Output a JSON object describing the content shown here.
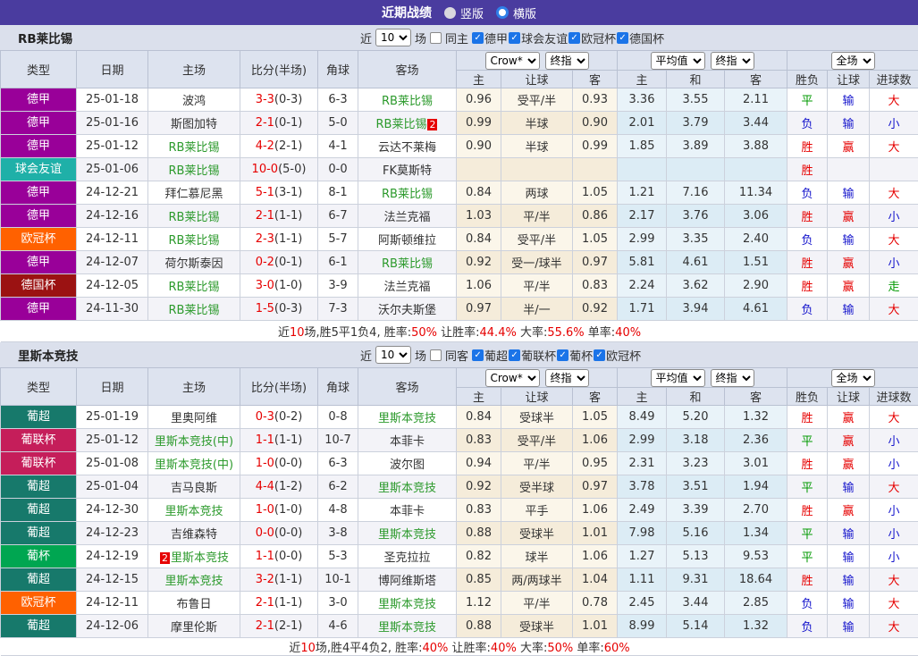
{
  "topbar": {
    "title": "近期战绩",
    "options": [
      {
        "label": "竖版",
        "selected": false
      },
      {
        "label": "横版",
        "selected": true
      }
    ]
  },
  "ui": {
    "near_label": "近",
    "matches_label": "场",
    "col_type": "类型",
    "col_date": "日期",
    "col_home": "主场",
    "col_score": "比分(半场)",
    "col_corner": "角球",
    "col_away": "客场",
    "sub_home": "主",
    "sub_handicap": "让球",
    "sub_away": "客",
    "sub_draw": "和",
    "sub_result": "胜负",
    "sub_goals": "进球数",
    "dd_crow": "Crow*",
    "dd_final": "终指",
    "dd_avg": "平均值",
    "dd_full": "全场"
  },
  "colors": {
    "topbar_bg": "#4a3c9f",
    "band_bg": "#dbe0ec",
    "header_bg": "#dde3ef",
    "checkbox_blue": "#1b74e8",
    "accent_red": "#e60000",
    "accent_blue": "#1414cc",
    "accent_green": "#009900",
    "team_green": "#2c9a2c",
    "badge": {
      "德甲": "#990099",
      "球会友谊": "#1fb0a8",
      "欧冠杯": "#ff6100",
      "德国杯": "#9b1212",
      "葡超": "#17796b",
      "葡联杯": "#c51e5a",
      "葡杯": "#00a651"
    }
  },
  "result_colors": {
    "胜": "red",
    "赢": "red",
    "大": "red",
    "负": "blue",
    "输": "blue",
    "小": "blue",
    "平": "green",
    "走": "green"
  },
  "tables": [
    {
      "team": "RB莱比锡",
      "near_count": "10",
      "same_label": "同主",
      "same_checked": false,
      "leagues": [
        {
          "label": "德甲",
          "checked": true
        },
        {
          "label": "球会友谊",
          "checked": true
        },
        {
          "label": "欧冠杯",
          "checked": true
        },
        {
          "label": "德国杯",
          "checked": true
        }
      ],
      "rows": [
        {
          "league": "德甲",
          "date": "25-01-18",
          "home": "波鸿",
          "home_green": false,
          "home_badge": "",
          "score": "3-3",
          "half": "(0-3)",
          "corner": "6-3",
          "away": "RB莱比锡",
          "away_green": true,
          "away_badge": "",
          "crow_home": "0.96",
          "handicap": "受平/半",
          "crow_away": "0.93",
          "avg_home": "3.36",
          "avg_draw": "3.55",
          "avg_away": "2.11",
          "result": "平",
          "let_result": "输",
          "goal_result": "大"
        },
        {
          "league": "德甲",
          "date": "25-01-16",
          "home": "斯图加特",
          "home_green": false,
          "home_badge": "",
          "score": "2-1",
          "half": "(0-1)",
          "corner": "5-0",
          "away": "RB莱比锡",
          "away_green": true,
          "away_badge": "2",
          "crow_home": "0.99",
          "handicap": "半球",
          "crow_away": "0.90",
          "avg_home": "2.01",
          "avg_draw": "3.79",
          "avg_away": "3.44",
          "result": "负",
          "let_result": "输",
          "goal_result": "小"
        },
        {
          "league": "德甲",
          "date": "25-01-12",
          "home": "RB莱比锡",
          "home_green": true,
          "home_badge": "",
          "score": "4-2",
          "half": "(2-1)",
          "corner": "4-1",
          "away": "云达不莱梅",
          "away_green": false,
          "away_badge": "",
          "crow_home": "0.90",
          "handicap": "半球",
          "crow_away": "0.99",
          "avg_home": "1.85",
          "avg_draw": "3.89",
          "avg_away": "3.88",
          "result": "胜",
          "let_result": "赢",
          "goal_result": "大"
        },
        {
          "league": "球会友谊",
          "date": "25-01-06",
          "home": "RB莱比锡",
          "home_green": true,
          "home_badge": "",
          "score": "10-0",
          "half": "(5-0)",
          "corner": "0-0",
          "away": "FK莫斯特",
          "away_green": false,
          "away_badge": "",
          "crow_home": "",
          "handicap": "",
          "crow_away": "",
          "avg_home": "",
          "avg_draw": "",
          "avg_away": "",
          "result": "胜",
          "let_result": "",
          "goal_result": ""
        },
        {
          "league": "德甲",
          "date": "24-12-21",
          "home": "拜仁慕尼黑",
          "home_green": false,
          "home_badge": "",
          "score": "5-1",
          "half": "(3-1)",
          "corner": "8-1",
          "away": "RB莱比锡",
          "away_green": true,
          "away_badge": "",
          "crow_home": "0.84",
          "handicap": "两球",
          "crow_away": "1.05",
          "avg_home": "1.21",
          "avg_draw": "7.16",
          "avg_away": "11.34",
          "result": "负",
          "let_result": "输",
          "goal_result": "大"
        },
        {
          "league": "德甲",
          "date": "24-12-16",
          "home": "RB莱比锡",
          "home_green": true,
          "home_badge": "",
          "score": "2-1",
          "half": "(1-1)",
          "corner": "6-7",
          "away": "法兰克福",
          "away_green": false,
          "away_badge": "",
          "crow_home": "1.03",
          "handicap": "平/半",
          "crow_away": "0.86",
          "avg_home": "2.17",
          "avg_draw": "3.76",
          "avg_away": "3.06",
          "result": "胜",
          "let_result": "赢",
          "goal_result": "小"
        },
        {
          "league": "欧冠杯",
          "date": "24-12-11",
          "home": "RB莱比锡",
          "home_green": true,
          "home_badge": "",
          "score": "2-3",
          "half": "(1-1)",
          "corner": "5-7",
          "away": "阿斯顿维拉",
          "away_green": false,
          "away_badge": "",
          "crow_home": "0.84",
          "handicap": "受平/半",
          "crow_away": "1.05",
          "avg_home": "2.99",
          "avg_draw": "3.35",
          "avg_away": "2.40",
          "result": "负",
          "let_result": "输",
          "goal_result": "大"
        },
        {
          "league": "德甲",
          "date": "24-12-07",
          "home": "荷尔斯泰因",
          "home_green": false,
          "home_badge": "",
          "score": "0-2",
          "half": "(0-1)",
          "corner": "6-1",
          "away": "RB莱比锡",
          "away_green": true,
          "away_badge": "",
          "crow_home": "0.92",
          "handicap": "受一/球半",
          "crow_away": "0.97",
          "avg_home": "5.81",
          "avg_draw": "4.61",
          "avg_away": "1.51",
          "result": "胜",
          "let_result": "赢",
          "goal_result": "小"
        },
        {
          "league": "德国杯",
          "date": "24-12-05",
          "home": "RB莱比锡",
          "home_green": true,
          "home_badge": "",
          "score": "3-0",
          "half": "(1-0)",
          "corner": "3-9",
          "away": "法兰克福",
          "away_green": false,
          "away_badge": "",
          "crow_home": "1.06",
          "handicap": "平/半",
          "crow_away": "0.83",
          "avg_home": "2.24",
          "avg_draw": "3.62",
          "avg_away": "2.90",
          "result": "胜",
          "let_result": "赢",
          "goal_result": "走"
        },
        {
          "league": "德甲",
          "date": "24-11-30",
          "home": "RB莱比锡",
          "home_green": true,
          "home_badge": "",
          "score": "1-5",
          "half": "(0-3)",
          "corner": "7-3",
          "away": "沃尔夫斯堡",
          "away_green": false,
          "away_badge": "",
          "crow_home": "0.97",
          "handicap": "半/一",
          "crow_away": "0.92",
          "avg_home": "1.71",
          "avg_draw": "3.94",
          "avg_away": "4.61",
          "result": "负",
          "let_result": "输",
          "goal_result": "大"
        }
      ],
      "summary_parts": [
        {
          "t": "近"
        },
        {
          "t": "10",
          "red": true
        },
        {
          "t": "场,胜5平1负4, 胜率:"
        },
        {
          "t": "50%",
          "red": true
        },
        {
          "t": " 让胜率:"
        },
        {
          "t": "44.4%",
          "red": true
        },
        {
          "t": " 大率:"
        },
        {
          "t": "55.6%",
          "red": true
        },
        {
          "t": " 单率:"
        },
        {
          "t": "40%",
          "red": true
        }
      ]
    },
    {
      "team": "里斯本竞技",
      "near_count": "10",
      "same_label": "同客",
      "same_checked": false,
      "leagues": [
        {
          "label": "葡超",
          "checked": true
        },
        {
          "label": "葡联杯",
          "checked": true
        },
        {
          "label": "葡杯",
          "checked": true
        },
        {
          "label": "欧冠杯",
          "checked": true
        }
      ],
      "rows": [
        {
          "league": "葡超",
          "date": "25-01-19",
          "home": "里奥阿维",
          "home_green": false,
          "home_badge": "",
          "score": "0-3",
          "half": "(0-2)",
          "corner": "0-8",
          "away": "里斯本竞技",
          "away_green": true,
          "away_badge": "",
          "crow_home": "0.84",
          "handicap": "受球半",
          "crow_away": "1.05",
          "avg_home": "8.49",
          "avg_draw": "5.20",
          "avg_away": "1.32",
          "result": "胜",
          "let_result": "赢",
          "goal_result": "大"
        },
        {
          "league": "葡联杯",
          "date": "25-01-12",
          "home": "里斯本竞技(中)",
          "home_green": true,
          "home_badge": "",
          "score": "1-1",
          "half": "(1-1)",
          "corner": "10-7",
          "away": "本菲卡",
          "away_green": false,
          "away_badge": "",
          "crow_home": "0.83",
          "handicap": "受平/半",
          "crow_away": "1.06",
          "avg_home": "2.99",
          "avg_draw": "3.18",
          "avg_away": "2.36",
          "result": "平",
          "let_result": "赢",
          "goal_result": "小"
        },
        {
          "league": "葡联杯",
          "date": "25-01-08",
          "home": "里斯本竞技(中)",
          "home_green": true,
          "home_badge": "",
          "score": "1-0",
          "half": "(0-0)",
          "corner": "6-3",
          "away": "波尔图",
          "away_green": false,
          "away_badge": "",
          "crow_home": "0.94",
          "handicap": "平/半",
          "crow_away": "0.95",
          "avg_home": "2.31",
          "avg_draw": "3.23",
          "avg_away": "3.01",
          "result": "胜",
          "let_result": "赢",
          "goal_result": "小"
        },
        {
          "league": "葡超",
          "date": "25-01-04",
          "home": "吉马良斯",
          "home_green": false,
          "home_badge": "",
          "score": "4-4",
          "half": "(1-2)",
          "corner": "6-2",
          "away": "里斯本竞技",
          "away_green": true,
          "away_badge": "",
          "crow_home": "0.92",
          "handicap": "受半球",
          "crow_away": "0.97",
          "avg_home": "3.78",
          "avg_draw": "3.51",
          "avg_away": "1.94",
          "result": "平",
          "let_result": "输",
          "goal_result": "大"
        },
        {
          "league": "葡超",
          "date": "24-12-30",
          "home": "里斯本竞技",
          "home_green": true,
          "home_badge": "",
          "score": "1-0",
          "half": "(1-0)",
          "corner": "4-8",
          "away": "本菲卡",
          "away_green": false,
          "away_badge": "",
          "crow_home": "0.83",
          "handicap": "平手",
          "crow_away": "1.06",
          "avg_home": "2.49",
          "avg_draw": "3.39",
          "avg_away": "2.70",
          "result": "胜",
          "let_result": "赢",
          "goal_result": "小"
        },
        {
          "league": "葡超",
          "date": "24-12-23",
          "home": "吉维森特",
          "home_green": false,
          "home_badge": "",
          "score": "0-0",
          "half": "(0-0)",
          "corner": "3-8",
          "away": "里斯本竞技",
          "away_green": true,
          "away_badge": "",
          "crow_home": "0.88",
          "handicap": "受球半",
          "crow_away": "1.01",
          "avg_home": "7.98",
          "avg_draw": "5.16",
          "avg_away": "1.34",
          "result": "平",
          "let_result": "输",
          "goal_result": "小"
        },
        {
          "league": "葡杯",
          "date": "24-12-19",
          "home": "里斯本竞技",
          "home_green": true,
          "home_badge": "2",
          "score": "1-1",
          "half": "(0-0)",
          "corner": "5-3",
          "away": "圣克拉拉",
          "away_green": false,
          "away_badge": "",
          "crow_home": "0.82",
          "handicap": "球半",
          "crow_away": "1.06",
          "avg_home": "1.27",
          "avg_draw": "5.13",
          "avg_away": "9.53",
          "result": "平",
          "let_result": "输",
          "goal_result": "小"
        },
        {
          "league": "葡超",
          "date": "24-12-15",
          "home": "里斯本竞技",
          "home_green": true,
          "home_badge": "",
          "score": "3-2",
          "half": "(1-1)",
          "corner": "10-1",
          "away": "博阿维斯塔",
          "away_green": false,
          "away_badge": "",
          "crow_home": "0.85",
          "handicap": "两/两球半",
          "crow_away": "1.04",
          "avg_home": "1.11",
          "avg_draw": "9.31",
          "avg_away": "18.64",
          "result": "胜",
          "let_result": "输",
          "goal_result": "大"
        },
        {
          "league": "欧冠杯",
          "date": "24-12-11",
          "home": "布鲁日",
          "home_green": false,
          "home_badge": "",
          "score": "2-1",
          "half": "(1-1)",
          "corner": "3-0",
          "away": "里斯本竞技",
          "away_green": true,
          "away_badge": "",
          "crow_home": "1.12",
          "handicap": "平/半",
          "crow_away": "0.78",
          "avg_home": "2.45",
          "avg_draw": "3.44",
          "avg_away": "2.85",
          "result": "负",
          "let_result": "输",
          "goal_result": "大"
        },
        {
          "league": "葡超",
          "date": "24-12-06",
          "home": "摩里伦斯",
          "home_green": false,
          "home_badge": "",
          "score": "2-1",
          "half": "(2-1)",
          "corner": "4-6",
          "away": "里斯本竞技",
          "away_green": true,
          "away_badge": "",
          "crow_home": "0.88",
          "handicap": "受球半",
          "crow_away": "1.01",
          "avg_home": "8.99",
          "avg_draw": "5.14",
          "avg_away": "1.32",
          "result": "负",
          "let_result": "输",
          "goal_result": "大"
        }
      ],
      "summary_parts": [
        {
          "t": "近"
        },
        {
          "t": "10",
          "red": true
        },
        {
          "t": "场,胜4平4负2, 胜率:"
        },
        {
          "t": "40%",
          "red": true
        },
        {
          "t": " 让胜率:"
        },
        {
          "t": "40%",
          "red": true
        },
        {
          "t": " 大率:"
        },
        {
          "t": "50%",
          "red": true
        },
        {
          "t": " 单率:"
        },
        {
          "t": "60%",
          "red": true
        }
      ]
    }
  ]
}
